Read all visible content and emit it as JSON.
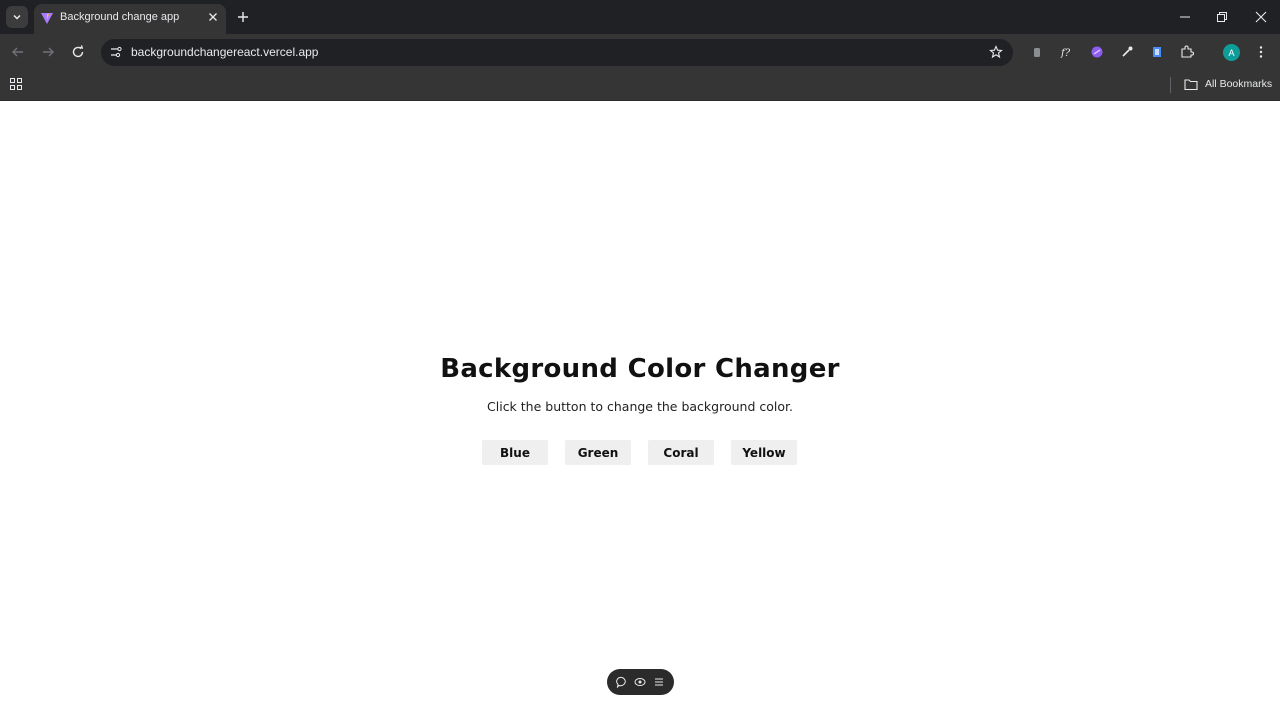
{
  "browser": {
    "tab_title": "Background change app",
    "url": "backgroundchangereact.vercel.app",
    "bookmarks_label": "All Bookmarks",
    "profile_initial": "A"
  },
  "page": {
    "heading": "Background Color Changer",
    "subtitle": "Click the button to change the background color.",
    "buttons": [
      "Blue",
      "Green",
      "Coral",
      "Yellow"
    ]
  },
  "icons": {
    "tab_search": "chevron-down-icon",
    "favicon": "vite-logo-icon",
    "floating_bar": [
      "comment-icon",
      "eye-icon",
      "menu-icon"
    ]
  },
  "colors": {
    "chrome_dark": "#202124",
    "chrome_toolbar": "#353535",
    "button_bg": "#efefef",
    "avatar": "#0f9d9a"
  }
}
